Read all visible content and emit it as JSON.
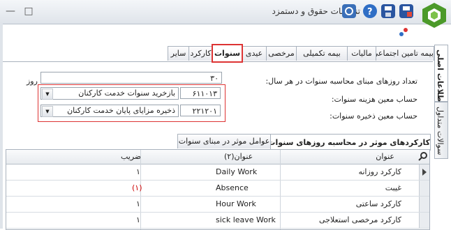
{
  "window": {
    "title": "تنظیمات حقوق و دستمزد",
    "buttons": {
      "minimize": "—",
      "restore": "□",
      "close": "✕"
    }
  },
  "toolbar_icons": [
    "settings-icon",
    "help-icon",
    "save-icon",
    "save-as-icon"
  ],
  "main_tabs": [
    {
      "label": "بیمه تامین اجتماعی",
      "active": false
    },
    {
      "label": "مالیات",
      "active": false
    },
    {
      "label": "بیمه تکمیلی",
      "active": false
    },
    {
      "label": "مرخصی",
      "active": false
    },
    {
      "label": "عیدی",
      "active": false
    },
    {
      "label": "سنوات",
      "active": true
    },
    {
      "label": "کارکرد",
      "active": false
    },
    {
      "label": "سایر",
      "active": false
    }
  ],
  "side_tabs": [
    {
      "label": "اطلاعات اصلی",
      "active": true
    },
    {
      "label": "سوالات متداول",
      "active": false
    }
  ],
  "form": {
    "days_label": "تعداد روزهای مبنای محاسبه سنوات در هر سال:",
    "days_value": "۳۰",
    "days_unit": "روز",
    "expense_label": "حساب معین هزینه سنوات:",
    "expense_code": "۶۱۱۰۱۳",
    "expense_name": "بازخرید سنوات خدمت کارکنان",
    "reserve_label": "حساب معین ذخیره سنوات:",
    "reserve_code": "۲۲۱۲۰۱",
    "reserve_name": "ذخیره مزایای پایان خدمت کارکنان"
  },
  "sub_tabs": [
    {
      "label": "کارکردهای موثر در محاسبه روزهای سنوات",
      "active": true
    },
    {
      "label": "عوامل موثر در مبنای سنوات",
      "active": false
    }
  ],
  "grid": {
    "columns": {
      "title": "عنوان",
      "title2": "عنوان(۲)",
      "factor": "ضریب"
    },
    "rows": [
      {
        "title": "کارکرد روزانه",
        "title2": "Daily Work",
        "factor": "۱",
        "negative": false
      },
      {
        "title": "غیبت",
        "title2": "Absence",
        "factor": "(۱)",
        "negative": true
      },
      {
        "title": "کارکرد ساعتی",
        "title2": "Hour Work",
        "factor": "۱",
        "negative": false
      },
      {
        "title": "کارکرد مرخصی استعلاجی",
        "title2": "sick leave Work",
        "factor": "۱",
        "negative": false
      }
    ]
  },
  "colors": {
    "highlight": "#dd3333",
    "negative": "#cc0000"
  }
}
